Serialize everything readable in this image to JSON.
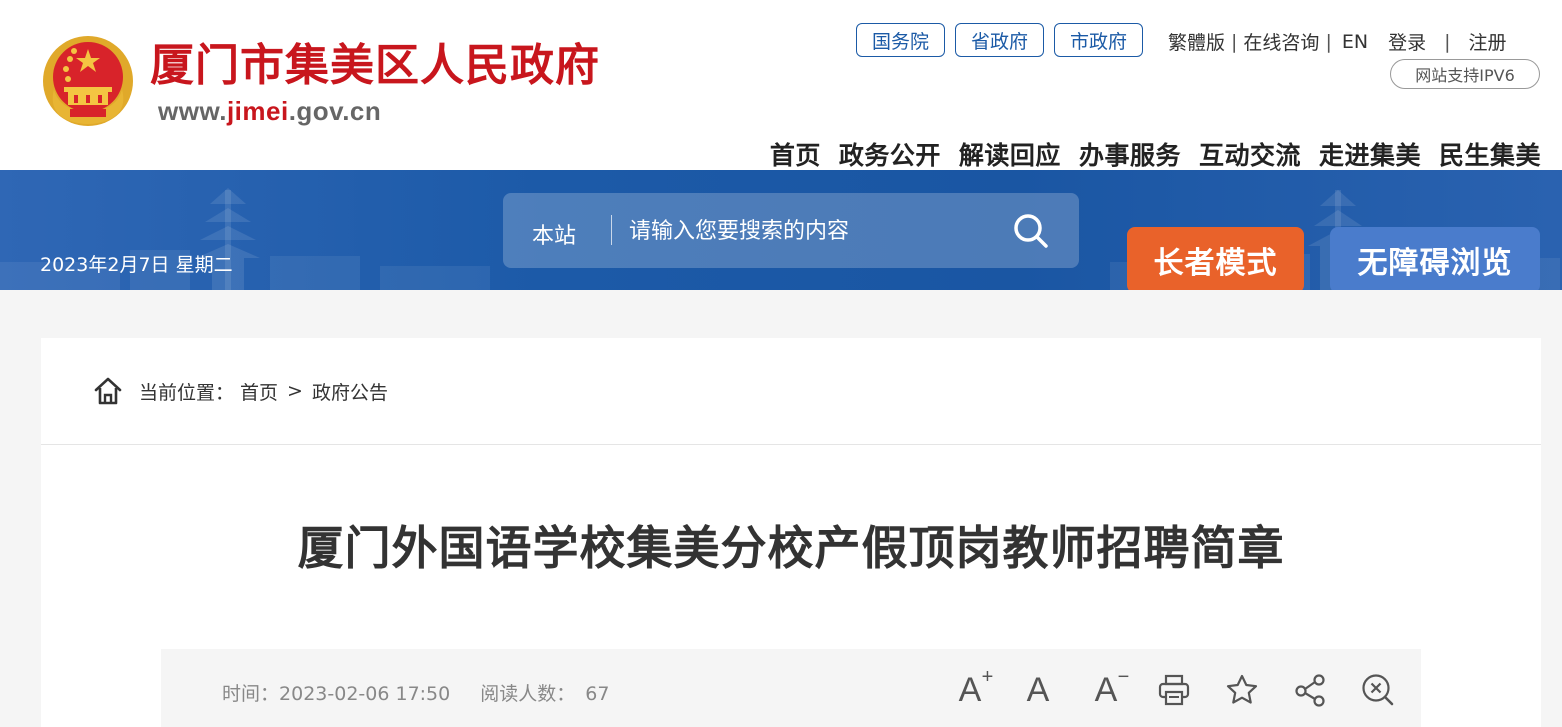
{
  "header": {
    "site_name": "厦门市集美区人民政府",
    "site_url_prefix": "www.",
    "site_url_highlight": "jimei",
    "site_url_suffix": ".gov.cn",
    "gov_links": [
      "国务院",
      "省政府",
      "市政府"
    ],
    "top_links": [
      "繁體版",
      "在线咨询",
      "EN",
      "登录",
      "注册"
    ],
    "ipv6_label": "网站支持IPV6",
    "nav": [
      "首页",
      "政务公开",
      "解读回应",
      "办事服务",
      "互动交流",
      "走进集美",
      "民生集美"
    ]
  },
  "banner": {
    "date": "2023年2月7日 星期二",
    "search_scope": "本站",
    "search_placeholder": "请输入您要搜索的内容",
    "elder_mode": "长者模式",
    "accessible_browse": "无障碍浏览"
  },
  "breadcrumb": {
    "label": "当前位置：",
    "items": [
      "首页",
      "政府公告"
    ],
    "separator": ">"
  },
  "article": {
    "title": "厦门外国语学校集美分校产假顶岗教师招聘简章",
    "time_label": "时间：",
    "time_value": "2023-02-06 17:50",
    "views_label": "阅读人数：",
    "views_value": "67"
  },
  "tools": {
    "font_large": "A",
    "font_large_mark": "+",
    "font_normal": "A",
    "font_small": "A",
    "font_small_mark": "−"
  },
  "colors": {
    "brand_red": "#c8161d",
    "nav_blue": "#1b5aa6",
    "elder_orange": "#e9622a",
    "access_blue": "#4a7ccc"
  },
  "icons": [
    "emblem-icon",
    "search-icon",
    "home-icon",
    "print-icon",
    "star-icon",
    "share-icon",
    "close-icon"
  ]
}
